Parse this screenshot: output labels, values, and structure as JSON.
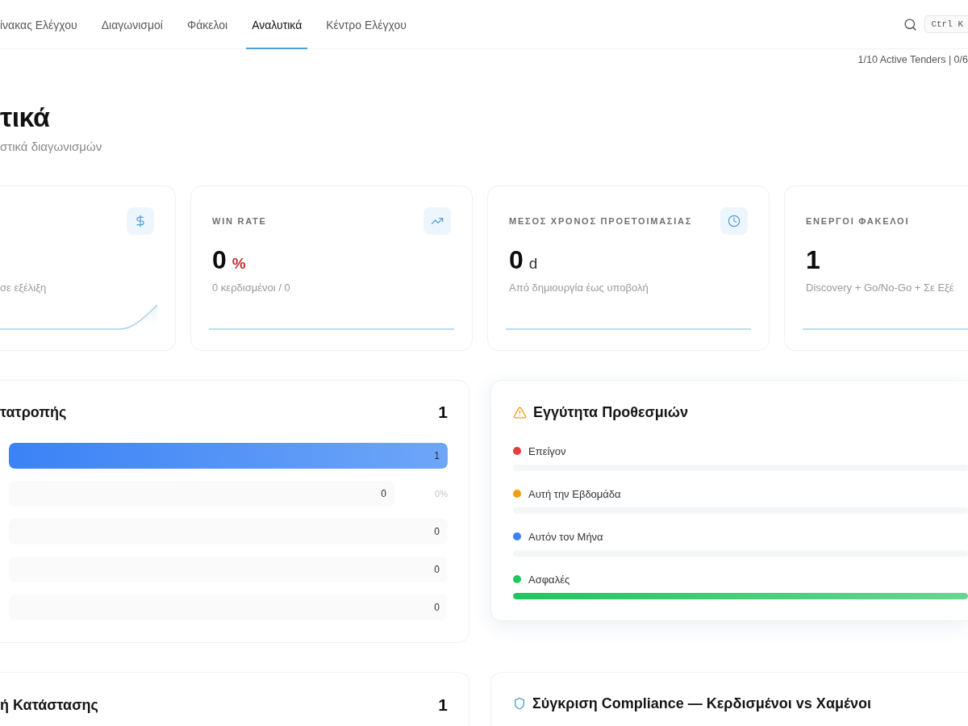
{
  "nav": {
    "tabs": [
      {
        "label": "ίνακας Ελέγχου",
        "selected": false
      },
      {
        "label": "Διαγωνισμοί",
        "selected": false
      },
      {
        "label": "Φάκελοι",
        "selected": false
      },
      {
        "label": "Αναλυτικά",
        "selected": true
      },
      {
        "label": "Κέντρο Ελέγχου",
        "selected": false
      }
    ],
    "shortcut": "Ctrl K"
  },
  "quota_status": "1/10 Active Tenders | 0/6",
  "header": {
    "title": "τικά",
    "subtitle": "στικά διαγωνισμών"
  },
  "kpis": [
    {
      "caption": "σε εξέλιξη",
      "kind": "rising"
    },
    {
      "label": "WIN RATE",
      "value": "0",
      "unit": "%",
      "alert": true,
      "caption": "0 κερδισμένοι / 0",
      "kind": "flat"
    },
    {
      "label": "ΜΕΣΟΣ ΧΡΟΝΟΣ ΠΡΟΕΤΟΙΜΑΣΙΑΣ",
      "value": "0",
      "unit": "d",
      "alert": false,
      "caption": "Από δημιουργία έως υποβολή",
      "kind": "flat"
    },
    {
      "label": "ΕΝΕΡΓΟΙ ΦΑΚΕΛΟΙ",
      "value": "1",
      "caption": "Discovery + Go/No-Go + Σε Εξέ",
      "kind": "flat"
    }
  ],
  "funnel": {
    "title": "τατροπής",
    "total": "1",
    "stages": [
      {
        "count": "1",
        "level": 1
      },
      {
        "count": "0",
        "level": 0,
        "conversion": "0%"
      },
      {
        "count": "0",
        "level": 0
      },
      {
        "count": "0",
        "level": 0
      },
      {
        "count": "0",
        "level": 0
      }
    ]
  },
  "deadlines": {
    "title": "Εγγύτητα Προθεσμιών",
    "groups": [
      {
        "label": "Επείγον",
        "color": "#e53e3e",
        "level": 0
      },
      {
        "label": "Αυτή την Εβδομάδα",
        "color": "#f59e0b",
        "level": 0
      },
      {
        "label": "Αυτόν τον Μήνα",
        "color": "#3b82f6",
        "level": 0
      },
      {
        "label": "Ασφαλές",
        "color": "#22c55e",
        "level": 1
      }
    ]
  },
  "status_summary": {
    "title": "ή Κατάστασης",
    "total": "1"
  },
  "compliance": {
    "title": "Σύγκριση Compliance — Κερδισμένοι vs Χαμένοι"
  }
}
